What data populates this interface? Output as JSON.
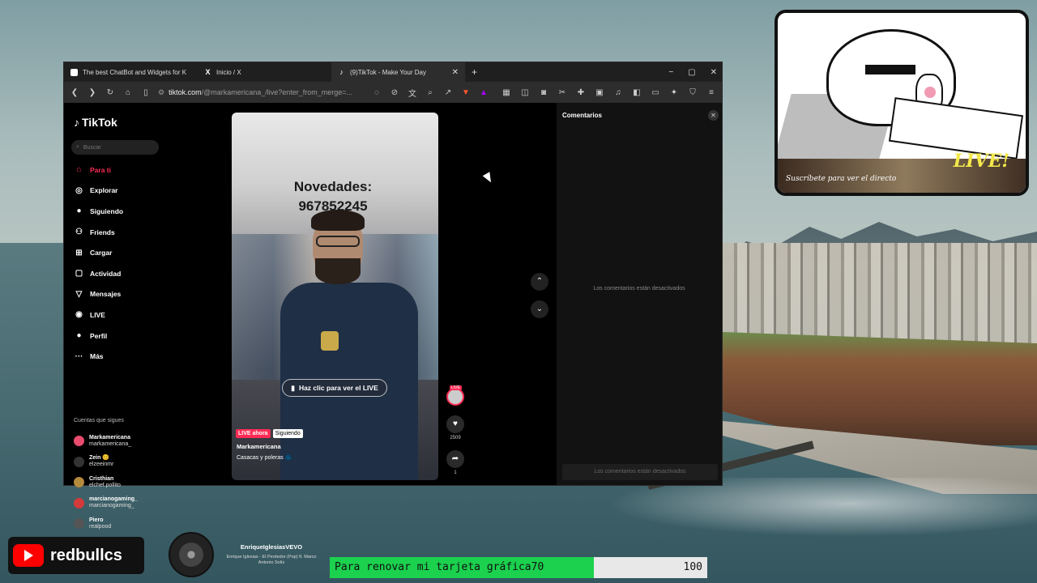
{
  "browser": {
    "tabs": [
      {
        "label": "The best ChatBot and Widgets for K",
        "active": false
      },
      {
        "label": "Inicio / X",
        "active": false
      },
      {
        "label": "(9)TikTok - Make Your Day",
        "active": true
      }
    ],
    "url_domain": "tiktok.com",
    "url_path": "/@markamericana_/live?enter_from_merge=...",
    "window_controls": [
      "−",
      "▢",
      "✕"
    ]
  },
  "tiktok": {
    "logo": "TikTok",
    "search_placeholder": "Buscar",
    "nav": [
      {
        "label": "Para ti",
        "icon": "home-icon",
        "glyph": "⌂",
        "active": true
      },
      {
        "label": "Explorar",
        "icon": "compass-icon",
        "glyph": "◎",
        "active": false
      },
      {
        "label": "Siguiendo",
        "icon": "following-icon",
        "glyph": "●",
        "active": false
      },
      {
        "label": "Friends",
        "icon": "friends-icon",
        "glyph": "⚇",
        "active": false
      },
      {
        "label": "Cargar",
        "icon": "upload-icon",
        "glyph": "⊞",
        "active": false
      },
      {
        "label": "Actividad",
        "icon": "activity-icon",
        "glyph": "▢",
        "active": false
      },
      {
        "label": "Mensajes",
        "icon": "messages-icon",
        "glyph": "▽",
        "active": false
      },
      {
        "label": "LIVE",
        "icon": "live-icon",
        "glyph": "◉",
        "active": false
      },
      {
        "label": "Perfil",
        "icon": "profile-icon",
        "glyph": "●",
        "active": false
      },
      {
        "label": "Más",
        "icon": "more-icon",
        "glyph": "···",
        "active": false
      }
    ],
    "following_title": "Cuentas que sigues",
    "following": [
      {
        "name": "Markamericana",
        "handle": "markamericana_"
      },
      {
        "name": "Zein 😊",
        "handle": "elzeeinmr"
      },
      {
        "name": "Cristhian",
        "handle": "elchef.pollito"
      },
      {
        "name": "marcianogaming_",
        "handle": "marcianogaming_"
      },
      {
        "name": "Piero",
        "handle": "realpood"
      }
    ],
    "video": {
      "title_line1": "Novedades:",
      "title_line2": "967852245",
      "watch_live": "Haz clic para ver el LIVE",
      "badge_live": "LIVE ahora",
      "badge_following": "Siguiendo",
      "username": "Markamericana",
      "description": "Casacas y poleras 🧥"
    },
    "actions": {
      "live_tag": "LIVE",
      "likes": "2509",
      "shares": "1"
    },
    "comments": {
      "title": "Comentarios",
      "disabled_message": "Los comentarios están desactivados",
      "input_placeholder": "Los comentarios están desactivados"
    }
  },
  "overlays": {
    "sticker_caption": "Suscríbete para ver el directo",
    "sticker_live": "LIVE!",
    "youtube_name": "redbullcs",
    "music_channel": "EnriqueIglesiasVEVO",
    "music_track": "Enrique Iglesias - El Perdedor (Pop) ft. Marco Antonio Solís",
    "goal_text": "Para renovar mi tarjeta gráfica70",
    "goal_target": "100",
    "goal_progress": 0.7
  }
}
